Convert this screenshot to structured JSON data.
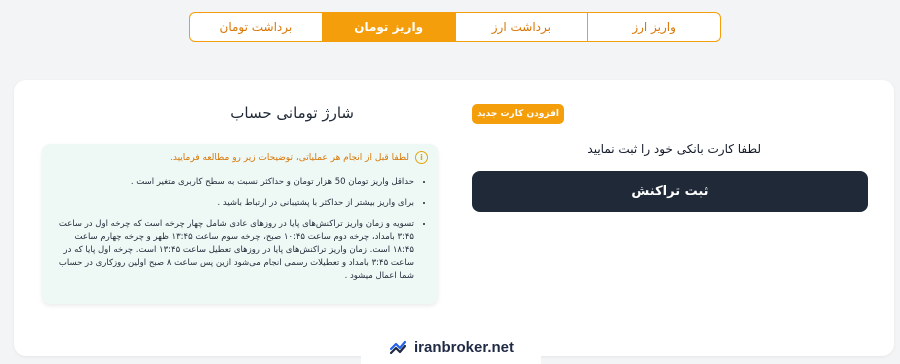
{
  "tabs": [
    {
      "label": "برداشت تومان",
      "active": false
    },
    {
      "label": "واریز تومان",
      "active": true
    },
    {
      "label": "برداشت ارز",
      "active": false
    },
    {
      "label": "واریز ارز",
      "active": false
    }
  ],
  "section": {
    "title": "شارژ تومانی حساب",
    "add_card_label": "افزودن کارت جدید",
    "prompt": "لطفا کارت بانکی خود را ثبت نمایید",
    "submit_label": "ثبت تراکنش"
  },
  "info": {
    "header": "لطفا قبل از انجام هر عملیاتی، توضیحات زیر رو مطالعه فرمایید.",
    "items": [
      "حداقل واریز تومان 50 هزار تومان و حداکثر نسبت به سطح کاربری متغیر است .",
      "برای واریز بیشتر از حداکثر با پشتیبانی در ارتباط باشید .",
      "تسویه و زمان واریز تراکنش‌های پایا در روزهای عادی شامل چهار چرخه است که چرخه اول در ساعت ۳:۴۵ بامداد، چرخه دوم ساعت ۱۰:۴۵ صبح، چرخه سوم ساعت ۱۳:۴۵ ظهر و چرخه چهارم ساعت ۱۸:۴۵ است. زمان واریز تراکنش‌های پایا در روزهای تعطیل ساعت ۱۳:۴۵ است. چرخه اول پایا که در ساعت ۳:۴۵ بامداد و تعطیلات رسمی انجام می‌شود ازین پس ساعت ۸ صبح اولین روزکاری در حساب شما اعمال میشود ."
    ]
  },
  "watermark": {
    "text": "iranbroker.net",
    "icon": "iranbroker-logo-icon"
  },
  "colors": {
    "accent": "#f59e0b",
    "dark_button": "#1f2937",
    "info_bg": "#eef8f5"
  }
}
